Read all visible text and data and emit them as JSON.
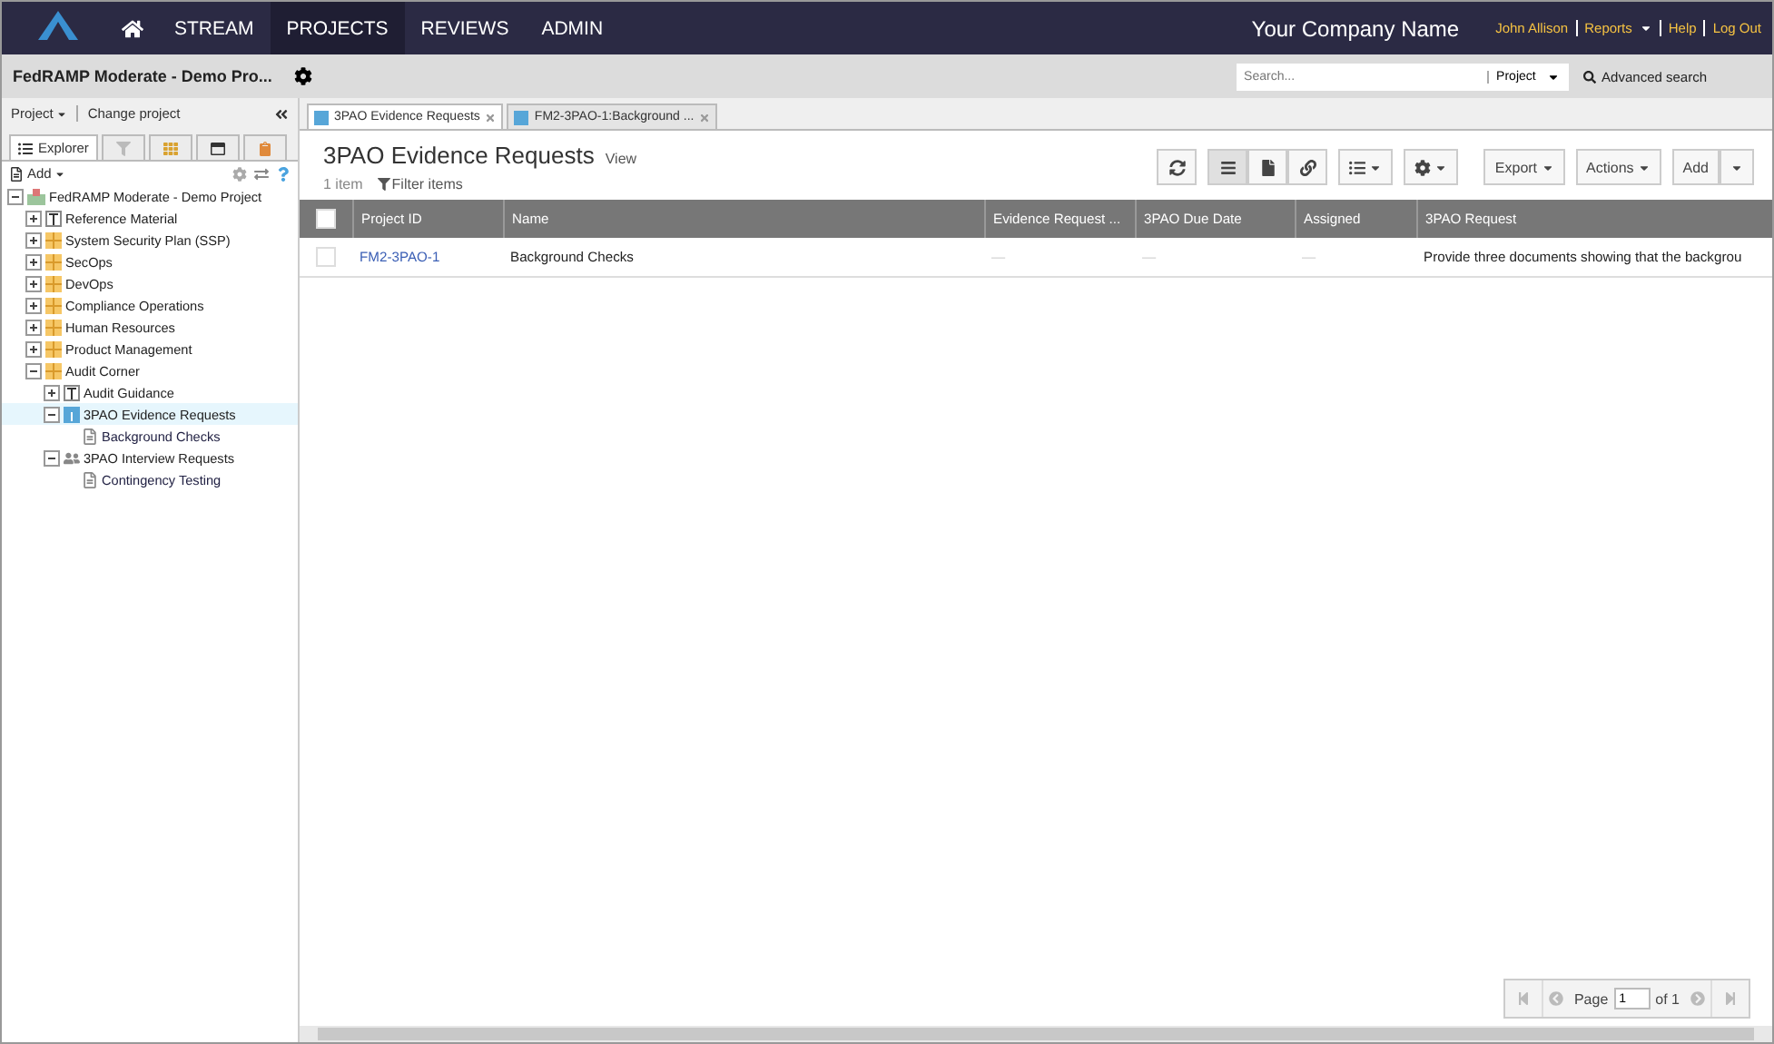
{
  "topnav": {
    "items": [
      {
        "label": "STREAM",
        "selected": false
      },
      {
        "label": "PROJECTS",
        "selected": true
      },
      {
        "label": "REVIEWS",
        "selected": false
      },
      {
        "label": "ADMIN",
        "selected": false
      }
    ],
    "company": "Your Company Name",
    "user_links": [
      "John Allison",
      "Reports",
      "Help",
      "Log Out"
    ]
  },
  "project_bar": {
    "title": "FedRAMP Moderate - Demo Pro...",
    "search": {
      "placeholder": "Search...",
      "scope": "Project"
    },
    "advanced_search": "Advanced search"
  },
  "sidebar": {
    "menu": "Project",
    "change": "Change project",
    "tabs": [
      {
        "kind": "explorer",
        "label": "Explorer",
        "selected": true
      },
      {
        "kind": "filter",
        "selected": false
      },
      {
        "kind": "grid",
        "selected": false
      },
      {
        "kind": "window",
        "selected": false
      },
      {
        "kind": "clipboard",
        "selected": false
      }
    ],
    "add": "Add",
    "tree": [
      {
        "label": "FedRAMP Moderate - Demo Project",
        "kind": "project",
        "expanded": true,
        "selected": false,
        "children": [
          {
            "label": "Reference Material",
            "kind": "text",
            "expanded": false,
            "selected": false
          },
          {
            "label": "System Security Plan (SSP)",
            "kind": "folder",
            "expanded": false,
            "selected": false
          },
          {
            "label": "SecOps",
            "kind": "folder",
            "expanded": false,
            "selected": false
          },
          {
            "label": "DevOps",
            "kind": "folder",
            "expanded": false,
            "selected": false
          },
          {
            "label": "Compliance Operations",
            "kind": "folder",
            "expanded": false,
            "selected": false
          },
          {
            "label": "Human Resources",
            "kind": "folder",
            "expanded": false,
            "selected": false
          },
          {
            "label": "Product Management",
            "kind": "folder",
            "expanded": false,
            "selected": false
          },
          {
            "label": "Audit Corner",
            "kind": "folder",
            "expanded": true,
            "selected": false,
            "children": [
              {
                "label": "Audit Guidance",
                "kind": "text",
                "expanded": false,
                "selected": false
              },
              {
                "label": "3PAO Evidence Requests",
                "kind": "set",
                "expanded": true,
                "selected": true,
                "children": [
                  {
                    "label": "Background Checks",
                    "kind": "item",
                    "selected": false
                  }
                ]
              },
              {
                "label": "3PAO Interview Requests",
                "kind": "people",
                "expanded": true,
                "selected": false,
                "children": [
                  {
                    "label": "Contingency Testing",
                    "kind": "item",
                    "selected": false
                  }
                ]
              }
            ]
          }
        ]
      }
    ]
  },
  "tabs": [
    {
      "label": "3PAO Evidence Requests",
      "selected": true
    },
    {
      "label": "FM2-3PAO-1:Background ...",
      "selected": false
    }
  ],
  "header": {
    "title": "3PAO Evidence Requests",
    "view": "View",
    "count": "1 item",
    "filter": "Filter items"
  },
  "toolbar": {
    "views": [
      {
        "kind": "list",
        "selected": true
      },
      {
        "kind": "document",
        "selected": false
      },
      {
        "kind": "link",
        "selected": false
      }
    ],
    "export": "Export",
    "actions": "Actions",
    "add": "Add"
  },
  "table": {
    "columns": [
      "Project ID",
      "Name",
      "Evidence Request ...",
      "3PAO Due Date",
      "Assigned",
      "3PAO Request"
    ],
    "all_checked": false,
    "rows": [
      {
        "checked": false,
        "cells": [
          "FM2-3PAO-1",
          "Background Checks",
          "—",
          "—",
          "—",
          "Provide three documents showing that the backgrou"
        ]
      }
    ]
  },
  "pager": {
    "label": "Page",
    "value": "1",
    "of": "of 1"
  }
}
